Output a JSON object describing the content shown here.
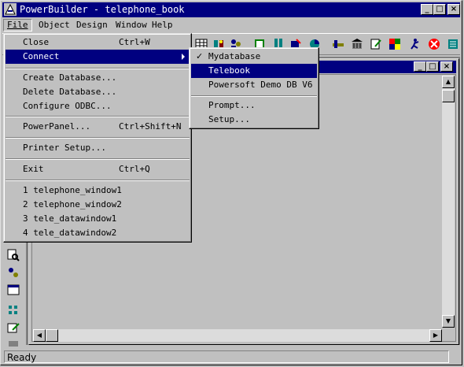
{
  "window": {
    "title": "PowerBuilder - telephone_book"
  },
  "caption_buttons": {
    "minimize": "_",
    "maximize": "□",
    "close": "×"
  },
  "menubar": {
    "items": [
      "File",
      "Object",
      "Design",
      "Window",
      "Help"
    ]
  },
  "file_menu": {
    "items": [
      {
        "label": "Close",
        "shortcut": "Ctrl+W"
      },
      {
        "label": "Connect",
        "shortcut": ""
      },
      {
        "label": "Create Database...",
        "shortcut": ""
      },
      {
        "label": "Delete Database...",
        "shortcut": ""
      },
      {
        "label": "Configure ODBC...",
        "shortcut": ""
      },
      {
        "label": "PowerPanel...",
        "shortcut": "Ctrl+Shift+N"
      },
      {
        "label": "Printer Setup...",
        "shortcut": ""
      },
      {
        "label": "Exit",
        "shortcut": "Ctrl+Q"
      },
      {
        "label": "1 telephone_window1",
        "shortcut": ""
      },
      {
        "label": "2 telephone_window2",
        "shortcut": ""
      },
      {
        "label": "3 tele_datawindow1",
        "shortcut": ""
      },
      {
        "label": "4 tele_datawindow2",
        "shortcut": ""
      }
    ]
  },
  "connect_submenu": {
    "items": [
      {
        "label": "Mydatabase",
        "checked": "✓"
      },
      {
        "label": "Telebook"
      },
      {
        "label": "Powersoft Demo DB V6"
      },
      {
        "label": "Prompt..."
      },
      {
        "label": "Setup..."
      }
    ]
  },
  "status": {
    "text": "Ready"
  },
  "icons": {
    "toolbar": [
      "table-icon",
      "database-icon",
      "users-icon",
      "library-icon",
      "script-icon",
      "structure-icon",
      "chart-icon",
      "pipeline-icon",
      "project-icon",
      "report-icon",
      "paint-icon",
      "run-icon",
      "debug-icon",
      "exit-icon"
    ],
    "leftbar": [
      "search-icon",
      "connect-icon",
      "window-icon",
      "grid-icon",
      "edit-icon",
      "misc-icon"
    ]
  },
  "colors": {
    "title_bar": "#000080",
    "highlight": "#000080",
    "face": "#c0c0c0"
  }
}
